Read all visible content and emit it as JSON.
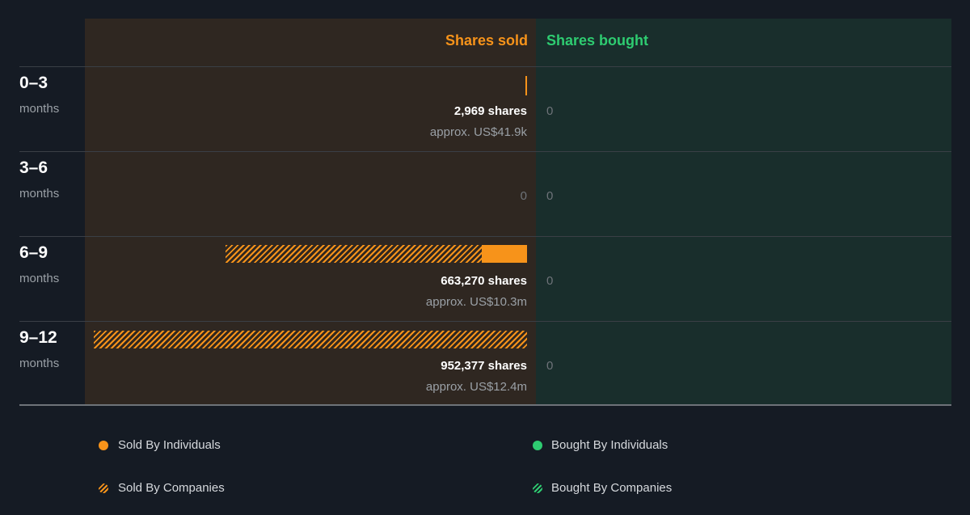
{
  "headers": {
    "sold": "Shares sold",
    "bought": "Shares bought"
  },
  "legend": {
    "sold_individuals": "Sold By Individuals",
    "sold_companies": "Sold By Companies",
    "bought_individuals": "Bought By Individuals",
    "bought_companies": "Bought By Companies"
  },
  "colors": {
    "sold": "#f7931a",
    "bought": "#2ecc71",
    "sold_panel": "#2f2721",
    "bought_panel": "#192e2c",
    "background": "#151b24"
  },
  "rows": [
    {
      "period": "0–3",
      "unit": "months",
      "shares_label": "2,969 shares",
      "approx_label": "approx. US$41.9k",
      "zero_sold": "",
      "zero_bought": "0"
    },
    {
      "period": "3–6",
      "unit": "months",
      "shares_label": "",
      "approx_label": "",
      "zero_sold": "0",
      "zero_bought": "0"
    },
    {
      "period": "6–9",
      "unit": "months",
      "shares_label": "663,270 shares",
      "approx_label": "approx. US$10.3m",
      "zero_sold": "",
      "zero_bought": "0"
    },
    {
      "period": "9–12",
      "unit": "months",
      "shares_label": "952,377 shares",
      "approx_label": "approx. US$12.4m",
      "zero_sold": "",
      "zero_bought": "0"
    }
  ],
  "chart_data": {
    "type": "bar",
    "orientation": "horizontal",
    "categories": [
      "0–3 months",
      "3–6 months",
      "6–9 months",
      "9–12 months"
    ],
    "series": [
      {
        "name": "Sold By Individuals",
        "values": [
          2969,
          0,
          100000,
          0
        ]
      },
      {
        "name": "Sold By Companies",
        "values": [
          0,
          0,
          563270,
          952377
        ]
      },
      {
        "name": "Bought By Individuals",
        "values": [
          0,
          0,
          0,
          0
        ]
      },
      {
        "name": "Bought By Companies",
        "values": [
          0,
          0,
          0,
          0
        ]
      }
    ],
    "totals_sold": [
      2969,
      0,
      663270,
      952377
    ],
    "totals_bought": [
      0,
      0,
      0,
      0
    ],
    "xlim": [
      0,
      952377
    ]
  }
}
